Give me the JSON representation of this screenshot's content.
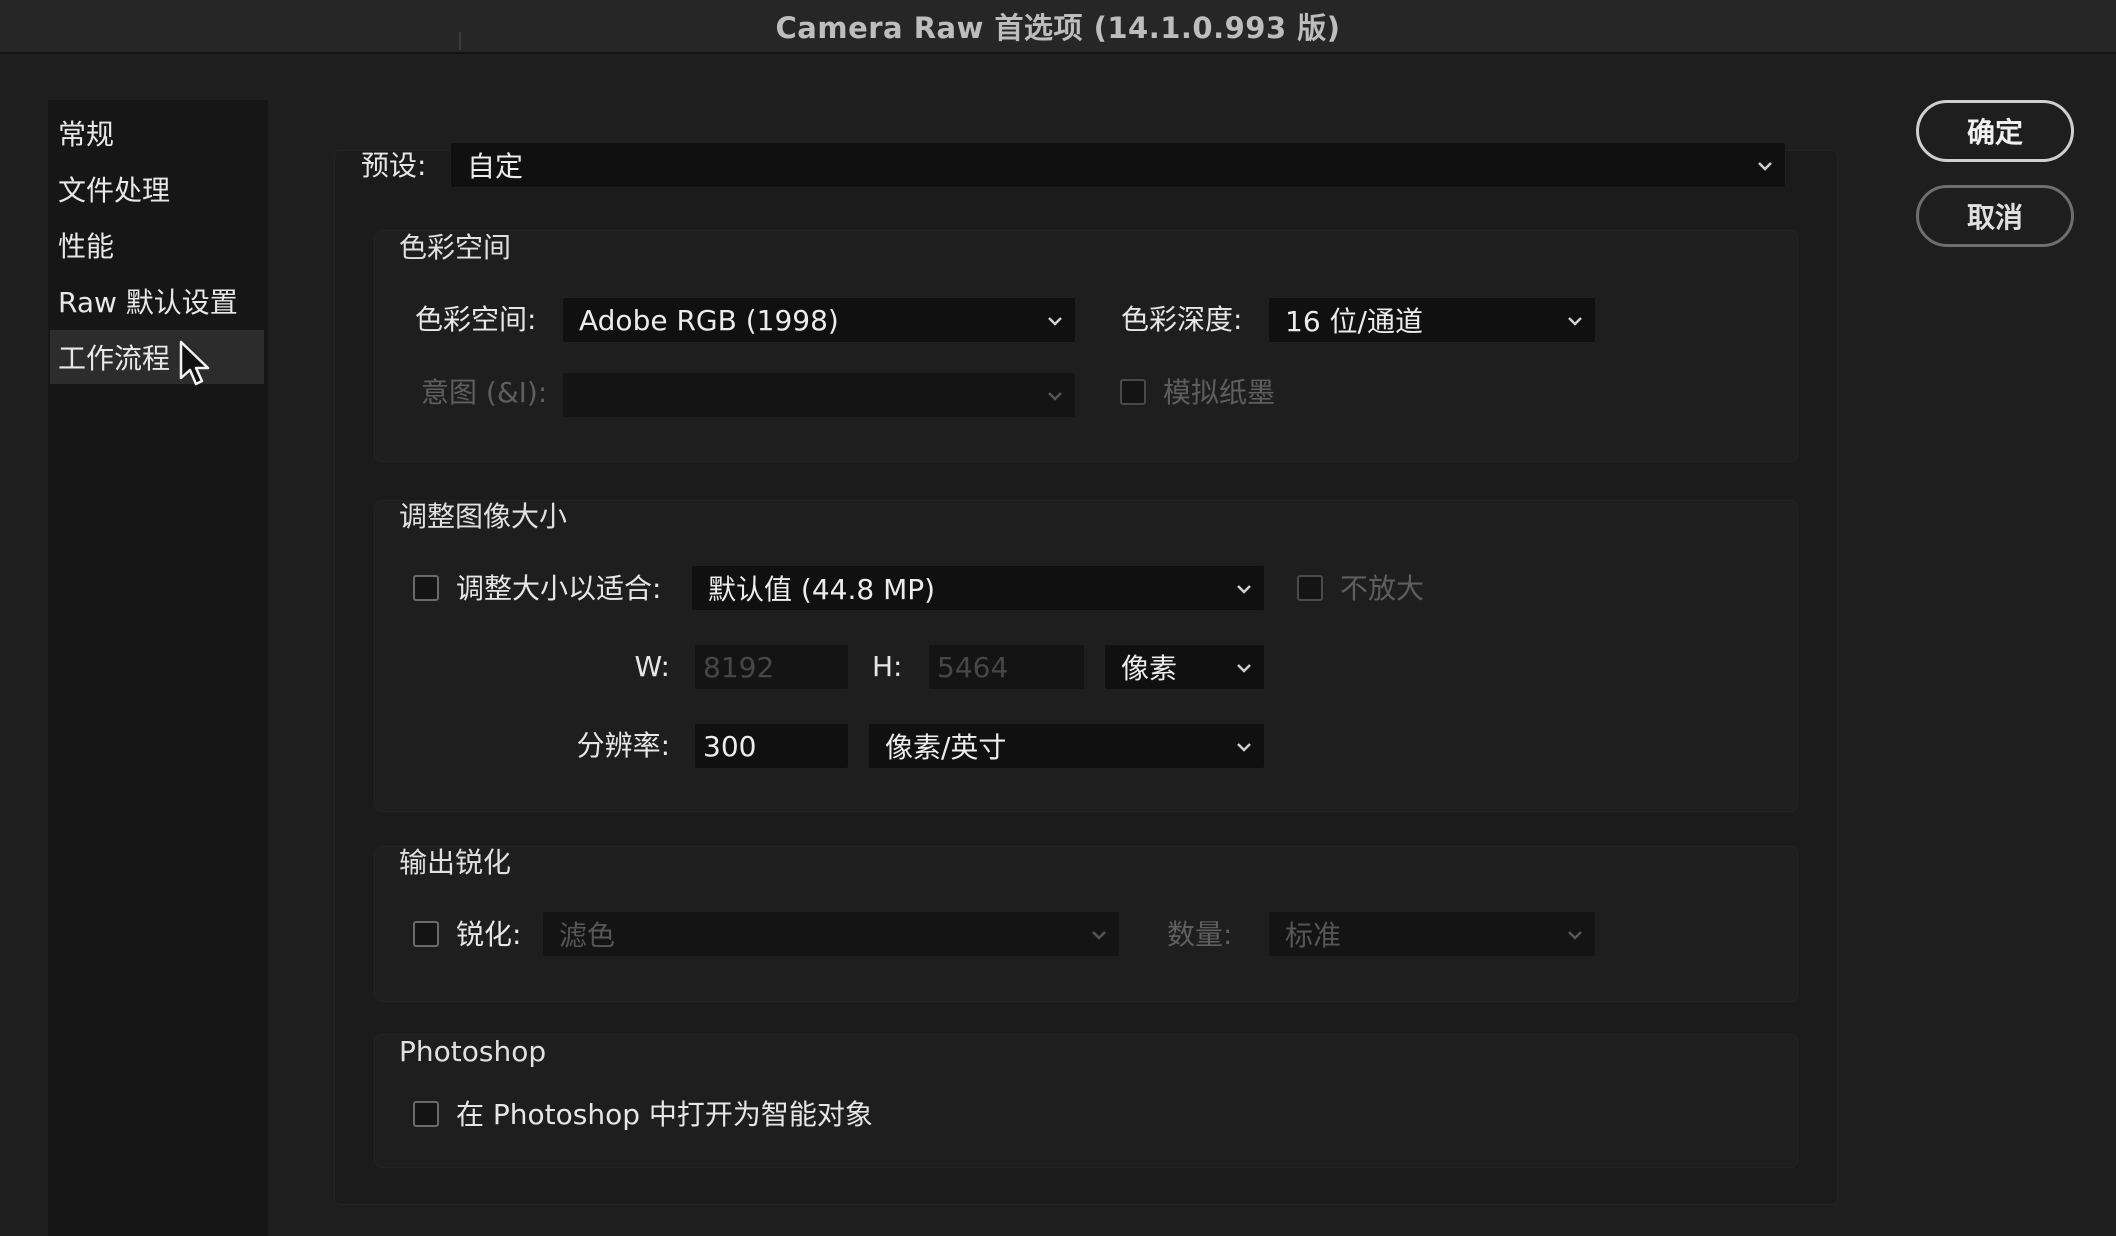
{
  "window": {
    "title": "Camera Raw 首选项 (14.1.0.993 版)"
  },
  "sidebar": {
    "items": [
      {
        "label": "常规"
      },
      {
        "label": "文件处理"
      },
      {
        "label": "性能"
      },
      {
        "label": "Raw 默认设置"
      },
      {
        "label": "工作流程"
      }
    ],
    "active_index": 4
  },
  "preset": {
    "label": "预设:",
    "value": "自定"
  },
  "color_space": {
    "title": "色彩空间",
    "space_label": "色彩空间:",
    "space_value": "Adobe RGB (1998)",
    "depth_label": "色彩深度:",
    "depth_value": "16 位/通道",
    "intent_label": "意图 (&I):",
    "intent_value": "",
    "simulate_label": "模拟纸墨"
  },
  "resize": {
    "title": "调整图像大小",
    "fit_label": "调整大小以适合:",
    "fit_value": "默认值 (44.8 MP)",
    "no_enlarge_label": "不放大",
    "w_label": "W:",
    "w_value": "8192",
    "h_label": "H:",
    "h_value": "5464",
    "unit_value": "像素",
    "resolution_label": "分辨率:",
    "resolution_value": "300",
    "resolution_unit": "像素/英寸"
  },
  "sharpen": {
    "title": "输出锐化",
    "sharpen_label": "锐化:",
    "sharpen_value": "滤色",
    "amount_label": "数量:",
    "amount_value": "标准"
  },
  "photoshop": {
    "title": "Photoshop",
    "smart_object_label": "在 Photoshop 中打开为智能对象"
  },
  "buttons": {
    "ok": "确定",
    "cancel": "取消"
  },
  "colors": {
    "background": "#1e1e1e",
    "field": "#101010",
    "text": "#e6e6e6",
    "disabled": "#5e5e5e"
  }
}
